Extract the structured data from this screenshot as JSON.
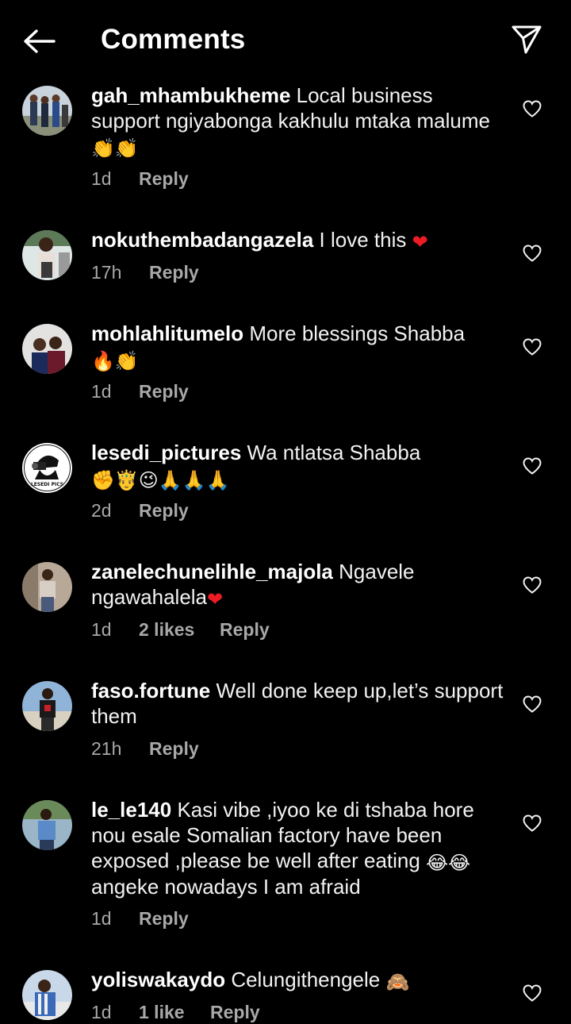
{
  "header": {
    "title": "Comments",
    "back_icon": "arrow-left-icon",
    "share_icon": "paper-plane-icon"
  },
  "comments": [
    {
      "username": "gah_mhambukheme",
      "text": "Local business support ngiyabonga kakhulu mtaka malume",
      "emoji": "👏👏",
      "time": "1d",
      "likes": "",
      "reply": "Reply"
    },
    {
      "username": "nokuthembadangazela",
      "text": "I love this",
      "emoji": "❤",
      "time": "17h",
      "likes": "",
      "reply": "Reply"
    },
    {
      "username": "mohlahlitumelo",
      "text": "More blessings Shabba",
      "emoji": "🔥👏",
      "time": "1d",
      "likes": "",
      "reply": "Reply"
    },
    {
      "username": "lesedi_pictures",
      "text": "Wa ntlatsa Shabba",
      "emoji": "✊🤴😉🙏🙏🙏",
      "time": "2d",
      "likes": "",
      "reply": "Reply"
    },
    {
      "username": "zanelechunelihle_majola",
      "text": "Ngavele ngawahalela",
      "emoji": "❤",
      "time": "1d",
      "likes": "2 likes",
      "reply": "Reply"
    },
    {
      "username": "faso.fortune",
      "text": "Well done keep up,let’s support them",
      "emoji": "",
      "time": "21h",
      "likes": "",
      "reply": "Reply"
    },
    {
      "username": "le_le140",
      "text": "Kasi vibe ,iyoo ke di tshaba hore nou esale Somalian factory have been exposed ,please be well after eating",
      "emoji": "😂😂",
      "text2": "angeke nowadays I am afraid",
      "time": "1d",
      "likes": "",
      "reply": "Reply"
    },
    {
      "username": "yoliswakaydo",
      "text": "Celungithengele",
      "emoji": "🙈",
      "time": "1d",
      "likes": "1 like",
      "reply": "Reply"
    }
  ],
  "colors": {
    "background": "#000000",
    "text": "#f2f2f2",
    "meta": "#a8a8a8",
    "heart_red": "#ed1c24"
  },
  "icons": {
    "like": "heart-outline-icon"
  }
}
